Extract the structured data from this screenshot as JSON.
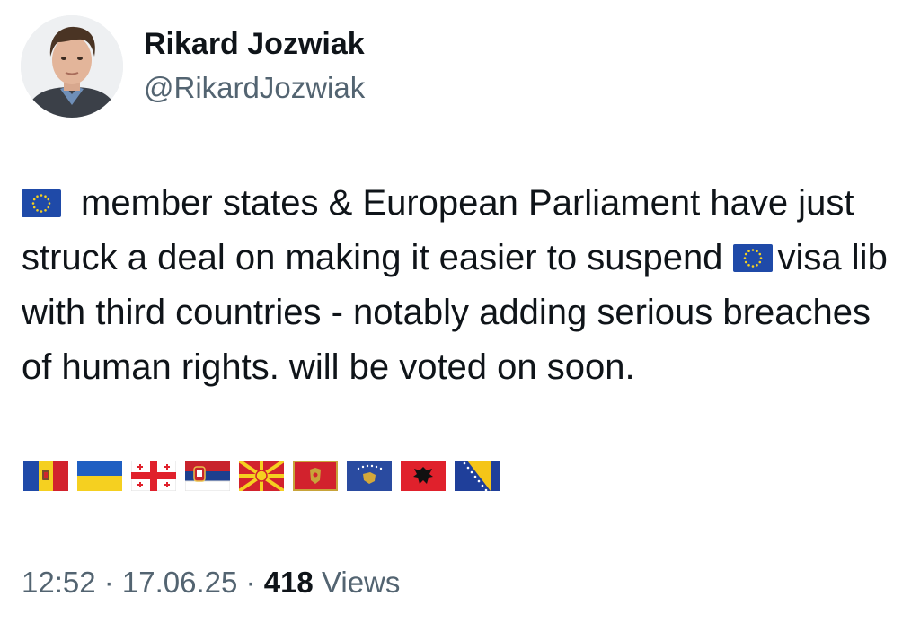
{
  "author": {
    "name": "Rikard Jozwiak",
    "handle": "@RikardJozwiak"
  },
  "tweet": {
    "line1": "member states & European Parliament have just struck a deal on making it easier to suspend ",
    "line2": "visa lib with third countries - notably adding serious breaches of human rights. will be voted on soon."
  },
  "meta": {
    "time": "12:52",
    "separator": " · ",
    "date": "17.06.25",
    "views_count": "418",
    "views_label": " Views"
  },
  "flags": [
    "eu-flag",
    "moldova-flag",
    "ukraine-flag",
    "georgia-flag",
    "serbia-flag",
    "north-macedonia-flag",
    "montenegro-flag",
    "kosovo-flag",
    "albania-flag",
    "bosnia-herzegovina-flag"
  ],
  "colors": {
    "text": "#0f1419",
    "secondary_text": "#536471",
    "background": "#ffffff"
  }
}
